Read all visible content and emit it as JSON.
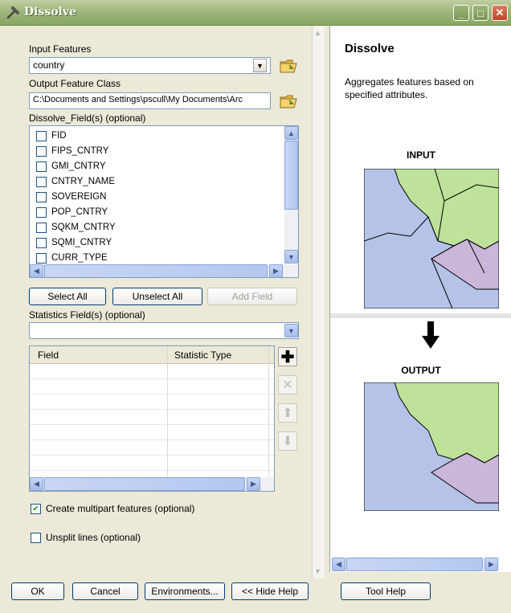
{
  "window": {
    "title": "Dissolve"
  },
  "form": {
    "input_features_label": "Input Features",
    "input_features_value": "country",
    "output_class_label": "Output Feature Class",
    "output_class_value": "C:\\Documents and Settings\\pscull\\My Documents\\Arc",
    "dissolve_fields_label": "Dissolve_Field(s) (optional)",
    "dissolve_fields": [
      "FID",
      "FIPS_CNTRY",
      "GMI_CNTRY",
      "CNTRY_NAME",
      "SOVEREIGN",
      "POP_CNTRY",
      "SQKM_CNTRY",
      "SQMI_CNTRY",
      "CURR_TYPE"
    ],
    "select_all_label": "Select All",
    "unselect_all_label": "Unselect All",
    "add_field_label": "Add Field",
    "statistics_label": "Statistics Field(s) (optional)",
    "statistics_value": "",
    "grid_col_field": "Field",
    "grid_col_stat": "Statistic Type",
    "multipart_label": "Create multipart features (optional)",
    "multipart_checked": true,
    "unsplit_label": "Unsplit lines (optional)",
    "unsplit_checked": false
  },
  "help": {
    "title": "Dissolve",
    "description": "Aggregates features based on specified attributes.",
    "input_label": "INPUT",
    "output_label": "OUTPUT"
  },
  "footer": {
    "ok_label": "OK",
    "cancel_label": "Cancel",
    "environments_label": "Environments...",
    "hide_help_label": "<< Hide Help",
    "tool_help_label": "Tool Help"
  },
  "colors": {
    "green_region": "#bfe29b",
    "purple_region": "#c9b6d9",
    "blue_region": "#b6c3e8"
  }
}
